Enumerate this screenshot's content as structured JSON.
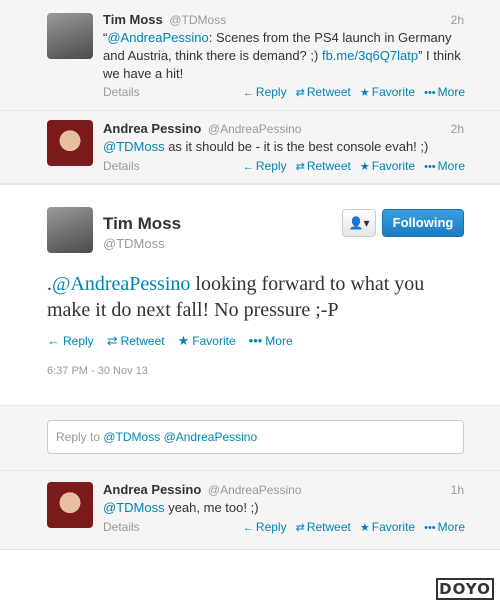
{
  "tweets": [
    {
      "name": "Tim Moss",
      "handle": "@TDMoss",
      "time": "2h",
      "text_quote_open": "“",
      "mention": "@AndreaPessino",
      "text_part1": ": Scenes from the PS4 launch in Germany and Austria, think there is demand? ;) ",
      "link": "fb.me/3q6Q7latp",
      "text_part2": "” I think we have a hit!",
      "details": "Details"
    },
    {
      "name": "Andrea Pessino",
      "handle": "@AndreaPessino",
      "time": "2h",
      "mention": "@TDMoss",
      "text_part1": " as it should be - it is the best console evah! ;)",
      "details": "Details"
    }
  ],
  "actions": {
    "reply": "Reply",
    "retweet": "Retweet",
    "favorite": "Favorite",
    "more": "More"
  },
  "main_tweet": {
    "name": "Tim Moss",
    "handle": "@TDMoss",
    "follow_button": "Following",
    "prefix": ".",
    "mention": "@AndreaPessino",
    "text": " looking forward to what you make it do next fall! No pressure ;-P",
    "timestamp": "6:37 PM - 30 Nov 13"
  },
  "reply_box": {
    "placeholder_prefix": "Reply to ",
    "mention1": "@TDMoss",
    "mention2": "@AndreaPessino"
  },
  "reply_tweet": {
    "name": "Andrea Pessino",
    "handle": "@AndreaPessino",
    "time": "1h",
    "mention": "@TDMoss",
    "text": " yeah, me too! ;)",
    "details": "Details"
  },
  "watermark": "DOYO",
  "icons": {
    "reply": "←",
    "retweet": "⇄",
    "favorite": "★",
    "more": "•••",
    "user": "👤"
  },
  "colors": {
    "link": "#0084b4",
    "follow_bg": "#2b8fd3"
  }
}
